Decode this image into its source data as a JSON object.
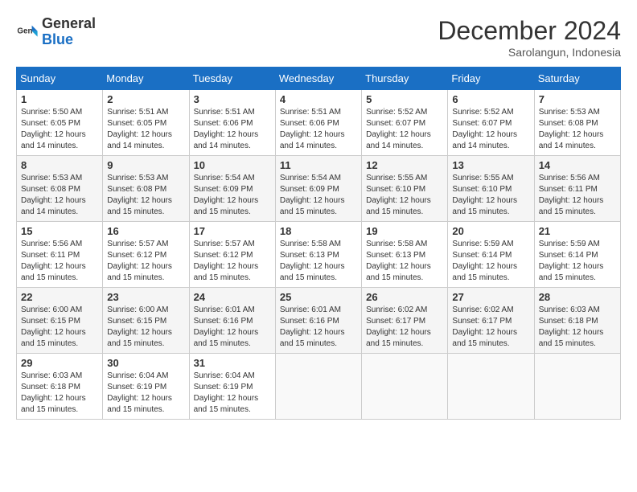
{
  "header": {
    "logo_general": "General",
    "logo_blue": "Blue",
    "title": "December 2024",
    "location": "Sarolangun, Indonesia"
  },
  "calendar": {
    "days_of_week": [
      "Sunday",
      "Monday",
      "Tuesday",
      "Wednesday",
      "Thursday",
      "Friday",
      "Saturday"
    ],
    "weeks": [
      [
        null,
        null,
        null,
        null,
        {
          "day": "5",
          "sunrise": "Sunrise: 5:52 AM",
          "sunset": "Sunset: 6:07 PM",
          "daylight": "Daylight: 12 hours and 14 minutes."
        },
        {
          "day": "6",
          "sunrise": "Sunrise: 5:52 AM",
          "sunset": "Sunset: 6:07 PM",
          "daylight": "Daylight: 12 hours and 14 minutes."
        },
        {
          "day": "7",
          "sunrise": "Sunrise: 5:53 AM",
          "sunset": "Sunset: 6:08 PM",
          "daylight": "Daylight: 12 hours and 14 minutes."
        }
      ],
      [
        {
          "day": "1",
          "sunrise": "Sunrise: 5:50 AM",
          "sunset": "Sunset: 6:05 PM",
          "daylight": "Daylight: 12 hours and 14 minutes."
        },
        {
          "day": "2",
          "sunrise": "Sunrise: 5:51 AM",
          "sunset": "Sunset: 6:05 PM",
          "daylight": "Daylight: 12 hours and 14 minutes."
        },
        {
          "day": "3",
          "sunrise": "Sunrise: 5:51 AM",
          "sunset": "Sunset: 6:06 PM",
          "daylight": "Daylight: 12 hours and 14 minutes."
        },
        {
          "day": "4",
          "sunrise": "Sunrise: 5:51 AM",
          "sunset": "Sunset: 6:06 PM",
          "daylight": "Daylight: 12 hours and 14 minutes."
        },
        {
          "day": "5",
          "sunrise": "Sunrise: 5:52 AM",
          "sunset": "Sunset: 6:07 PM",
          "daylight": "Daylight: 12 hours and 14 minutes."
        },
        {
          "day": "6",
          "sunrise": "Sunrise: 5:52 AM",
          "sunset": "Sunset: 6:07 PM",
          "daylight": "Daylight: 12 hours and 14 minutes."
        },
        {
          "day": "7",
          "sunrise": "Sunrise: 5:53 AM",
          "sunset": "Sunset: 6:08 PM",
          "daylight": "Daylight: 12 hours and 14 minutes."
        }
      ],
      [
        {
          "day": "8",
          "sunrise": "Sunrise: 5:53 AM",
          "sunset": "Sunset: 6:08 PM",
          "daylight": "Daylight: 12 hours and 14 minutes."
        },
        {
          "day": "9",
          "sunrise": "Sunrise: 5:53 AM",
          "sunset": "Sunset: 6:08 PM",
          "daylight": "Daylight: 12 hours and 15 minutes."
        },
        {
          "day": "10",
          "sunrise": "Sunrise: 5:54 AM",
          "sunset": "Sunset: 6:09 PM",
          "daylight": "Daylight: 12 hours and 15 minutes."
        },
        {
          "day": "11",
          "sunrise": "Sunrise: 5:54 AM",
          "sunset": "Sunset: 6:09 PM",
          "daylight": "Daylight: 12 hours and 15 minutes."
        },
        {
          "day": "12",
          "sunrise": "Sunrise: 5:55 AM",
          "sunset": "Sunset: 6:10 PM",
          "daylight": "Daylight: 12 hours and 15 minutes."
        },
        {
          "day": "13",
          "sunrise": "Sunrise: 5:55 AM",
          "sunset": "Sunset: 6:10 PM",
          "daylight": "Daylight: 12 hours and 15 minutes."
        },
        {
          "day": "14",
          "sunrise": "Sunrise: 5:56 AM",
          "sunset": "Sunset: 6:11 PM",
          "daylight": "Daylight: 12 hours and 15 minutes."
        }
      ],
      [
        {
          "day": "15",
          "sunrise": "Sunrise: 5:56 AM",
          "sunset": "Sunset: 6:11 PM",
          "daylight": "Daylight: 12 hours and 15 minutes."
        },
        {
          "day": "16",
          "sunrise": "Sunrise: 5:57 AM",
          "sunset": "Sunset: 6:12 PM",
          "daylight": "Daylight: 12 hours and 15 minutes."
        },
        {
          "day": "17",
          "sunrise": "Sunrise: 5:57 AM",
          "sunset": "Sunset: 6:12 PM",
          "daylight": "Daylight: 12 hours and 15 minutes."
        },
        {
          "day": "18",
          "sunrise": "Sunrise: 5:58 AM",
          "sunset": "Sunset: 6:13 PM",
          "daylight": "Daylight: 12 hours and 15 minutes."
        },
        {
          "day": "19",
          "sunrise": "Sunrise: 5:58 AM",
          "sunset": "Sunset: 6:13 PM",
          "daylight": "Daylight: 12 hours and 15 minutes."
        },
        {
          "day": "20",
          "sunrise": "Sunrise: 5:59 AM",
          "sunset": "Sunset: 6:14 PM",
          "daylight": "Daylight: 12 hours and 15 minutes."
        },
        {
          "day": "21",
          "sunrise": "Sunrise: 5:59 AM",
          "sunset": "Sunset: 6:14 PM",
          "daylight": "Daylight: 12 hours and 15 minutes."
        }
      ],
      [
        {
          "day": "22",
          "sunrise": "Sunrise: 6:00 AM",
          "sunset": "Sunset: 6:15 PM",
          "daylight": "Daylight: 12 hours and 15 minutes."
        },
        {
          "day": "23",
          "sunrise": "Sunrise: 6:00 AM",
          "sunset": "Sunset: 6:15 PM",
          "daylight": "Daylight: 12 hours and 15 minutes."
        },
        {
          "day": "24",
          "sunrise": "Sunrise: 6:01 AM",
          "sunset": "Sunset: 6:16 PM",
          "daylight": "Daylight: 12 hours and 15 minutes."
        },
        {
          "day": "25",
          "sunrise": "Sunrise: 6:01 AM",
          "sunset": "Sunset: 6:16 PM",
          "daylight": "Daylight: 12 hours and 15 minutes."
        },
        {
          "day": "26",
          "sunrise": "Sunrise: 6:02 AM",
          "sunset": "Sunset: 6:17 PM",
          "daylight": "Daylight: 12 hours and 15 minutes."
        },
        {
          "day": "27",
          "sunrise": "Sunrise: 6:02 AM",
          "sunset": "Sunset: 6:17 PM",
          "daylight": "Daylight: 12 hours and 15 minutes."
        },
        {
          "day": "28",
          "sunrise": "Sunrise: 6:03 AM",
          "sunset": "Sunset: 6:18 PM",
          "daylight": "Daylight: 12 hours and 15 minutes."
        }
      ],
      [
        {
          "day": "29",
          "sunrise": "Sunrise: 6:03 AM",
          "sunset": "Sunset: 6:18 PM",
          "daylight": "Daylight: 12 hours and 15 minutes."
        },
        {
          "day": "30",
          "sunrise": "Sunrise: 6:04 AM",
          "sunset": "Sunset: 6:19 PM",
          "daylight": "Daylight: 12 hours and 15 minutes."
        },
        {
          "day": "31",
          "sunrise": "Sunrise: 6:04 AM",
          "sunset": "Sunset: 6:19 PM",
          "daylight": "Daylight: 12 hours and 15 minutes."
        },
        null,
        null,
        null,
        null
      ]
    ]
  }
}
